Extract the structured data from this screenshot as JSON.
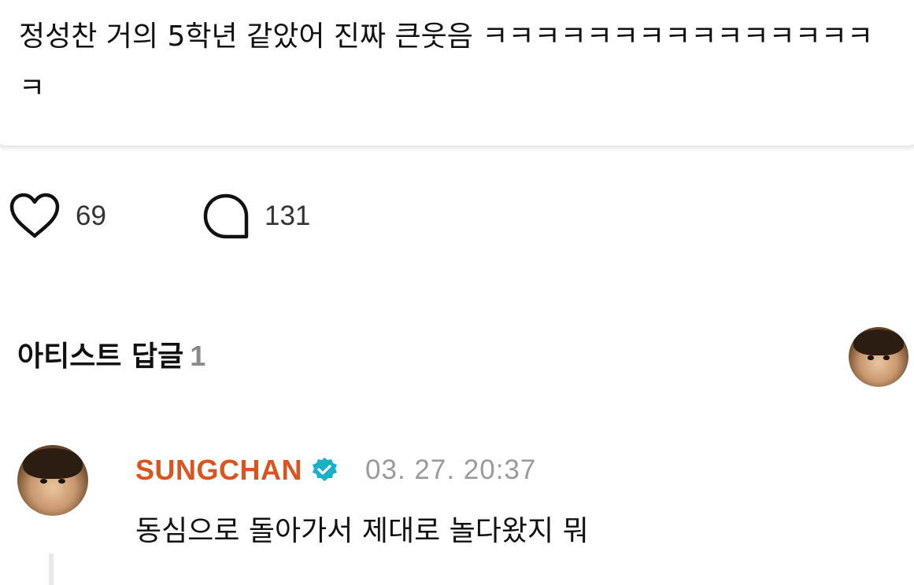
{
  "post": {
    "text": "정성찬 거의 5학년 같았어 진짜 큰웃음 ㅋㅋㅋㅋㅋㅋㅋㅋㅋㅋㅋㅋㅋㅋㅋㅋ"
  },
  "reactions": {
    "likes": "69",
    "comments": "131"
  },
  "artist_replies": {
    "title": "아티스트 답글",
    "count": "1"
  },
  "reply": {
    "author": "SUNGCHAN",
    "timestamp": "03. 27. 20:37",
    "text": "동심으로 돌아가서 제대로 놀다왔지 뭐"
  },
  "icons": {
    "like": "heart-icon",
    "comment": "speech-bubble-icon",
    "verified": "verified-badge-icon"
  },
  "colors": {
    "author": "#d9541e",
    "verified": "#1ab0c9",
    "timestamp": "#9a9a9a",
    "count_muted": "#8a8a8a"
  }
}
